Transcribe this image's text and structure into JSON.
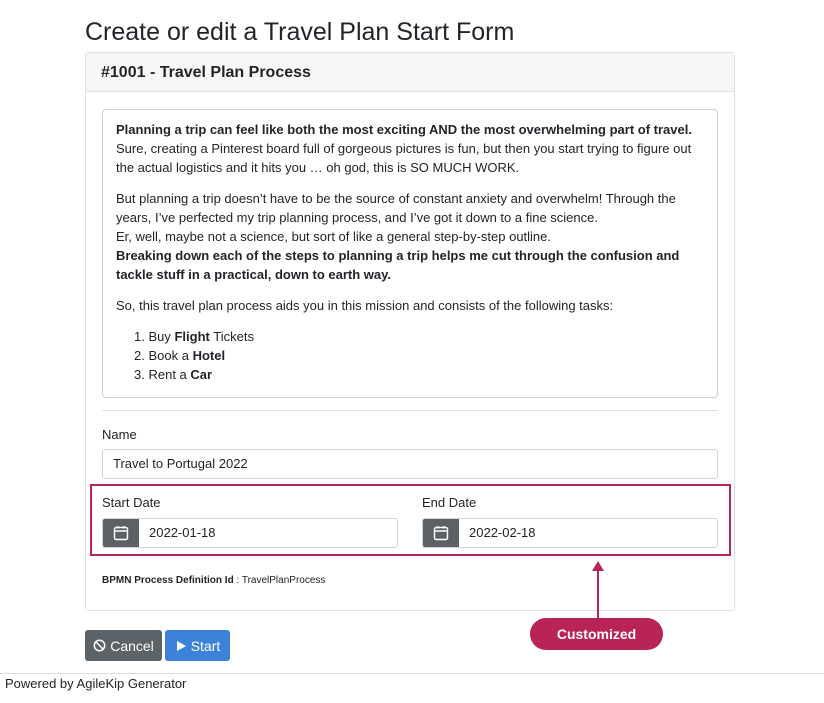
{
  "page": {
    "title": "Create or edit a Travel Plan Start Form"
  },
  "card": {
    "header": "#1001 - Travel Plan Process"
  },
  "description": {
    "p1_bold": "Planning a trip can feel like both the most exciting AND the most overwhelming part of travel.",
    "p1_rest": "Sure, creating a Pinterest board full of gorgeous pictures is fun, but then you start trying to figure out the actual logistics and it hits you … oh god, this is SO MUCH WORK.",
    "p2_line1": "But planning a trip doesn’t have to be the source of constant anxiety and overwhelm! Through the years, I’ve perfected my trip planning process, and I’ve got it down to a fine science.",
    "p2_line2": "Er, well, maybe not a science, but sort of like a general step-by-step outline.",
    "p2_bold": "Breaking down each of the steps to planning a trip helps me cut through the confusion and tackle stuff in a practical, down to earth way.",
    "p3": "So, this travel plan process aids you in this mission and consists of the following tasks:",
    "tasks": [
      {
        "num": "1.",
        "pre": "Buy ",
        "bold": "Flight",
        "post": " Tickets"
      },
      {
        "num": "2.",
        "pre": "Book a ",
        "bold": "Hotel",
        "post": ""
      },
      {
        "num": "3.",
        "pre": "Rent a ",
        "bold": "Car",
        "post": ""
      }
    ]
  },
  "form": {
    "name_label": "Name",
    "name_value": "Travel to Portugal 2022",
    "start_label": "Start Date",
    "start_value": "2022-01-18",
    "end_label": "End Date",
    "end_value": "2022-02-18",
    "bpmn_label": "BPMN Process Definition Id",
    "bpmn_sep": " : ",
    "bpmn_value": "TravelPlanProcess"
  },
  "annotation": {
    "label": "Customized",
    "color": "#b82456"
  },
  "buttons": {
    "cancel": "Cancel",
    "start": "Start"
  },
  "footer": {
    "text": "Powered by AgileKip Generator"
  },
  "icons": {
    "cancel": "ban-icon",
    "start": "play-icon",
    "calendar": "calendar-icon"
  }
}
